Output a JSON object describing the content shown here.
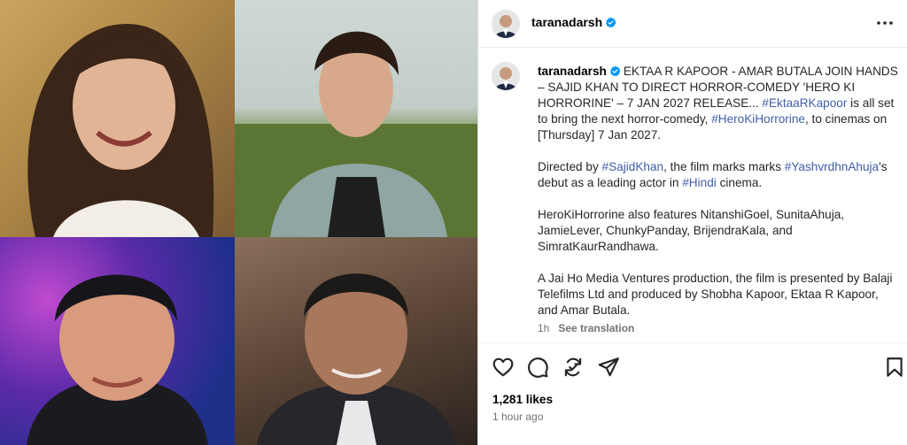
{
  "post": {
    "username": "taranadarsh",
    "caption": {
      "username": "taranadarsh",
      "p1_a": "EKTAA R KAPOOR - AMAR BUTALA JOIN HANDS – SAJID KHAN TO DIRECT HORROR-COMEDY 'HERO KI HORRORINE' – 7 JAN 2027 RELEASE... ",
      "p1_tag1": "#EktaaRKapoor",
      "p1_b": " is all set to bring the next horror-comedy, ",
      "p1_tag2": "#HeroKiHorrorine",
      "p1_c": ", to cinemas on [Thursday] 7 Jan 2027.",
      "p2_a": "Directed by ",
      "p2_tag1": "#SajidKhan",
      "p2_b": ", the film marks marks ",
      "p2_tag2": "#YashvrdhnAhuja",
      "p2_c": "'s debut as a leading actor in ",
      "p2_tag3": "#Hindi",
      "p2_d": " cinema.",
      "p3": "HeroKiHorrorine also features NitanshiGoel, SunitaAhuja, JamieLever, ChunkyPanday, BrijendraKala, and SimratKaurRandhawa.",
      "p4": "A Jai Ho Media Ventures production, the film is presented by Balaji Telefilms Ltd and produced by Shobha Kapoor, Ektaa R Kapoor, and Amar Butala."
    },
    "time_short": "1h",
    "see_translation": "See translation",
    "likes": "1,281 likes",
    "time_ago": "1 hour ago"
  },
  "icons": {
    "verified": "verified-badge-icon",
    "more": "more-options-icon",
    "like": "heart-icon",
    "comment": "comment-icon",
    "repost": "repost-icon",
    "share": "share-icon",
    "save": "bookmark-icon"
  },
  "colors": {
    "verified": "#0095f6",
    "hashtag": "#3f5fa8",
    "muted": "#737373"
  }
}
